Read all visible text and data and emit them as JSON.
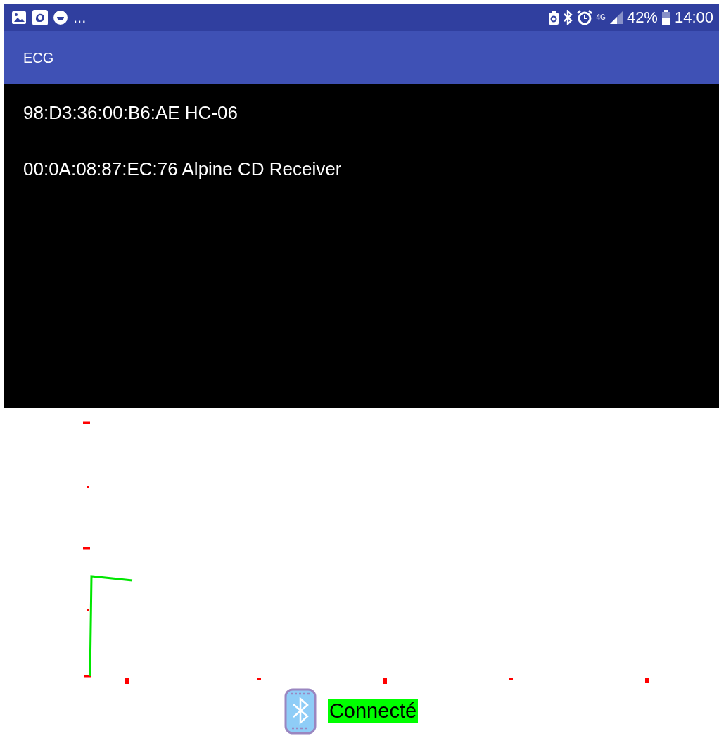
{
  "status_bar": {
    "overflow": "...",
    "network": "4G",
    "battery": "42%",
    "time": "14:00"
  },
  "app_bar": {
    "title": "ECG"
  },
  "devices": [
    {
      "address": "98:D3:36:00:B6:AE",
      "name": "HC-06"
    },
    {
      "address": "00:0A:08:87:EC:76",
      "name": "Alpine CD Receiver"
    }
  ],
  "connection": {
    "label": "Connecté",
    "connected": true
  }
}
